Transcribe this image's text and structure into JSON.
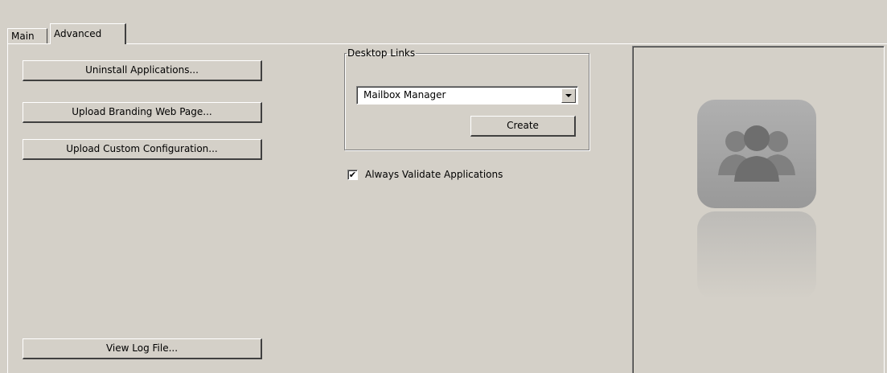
{
  "tabs": {
    "main": "Main",
    "advanced": "Advanced"
  },
  "left_buttons": {
    "uninstall": "Uninstall Applications...",
    "upload_branding": "Upload Branding Web Page...",
    "upload_config": "Upload Custom Configuration...",
    "view_log": "View Log File..."
  },
  "desktop_links": {
    "legend": "Desktop Links",
    "selected": "Mailbox Manager",
    "create_label": "Create"
  },
  "validate": {
    "label": "Always Validate Applications",
    "checked": true,
    "check_glyph": "✔"
  },
  "preview": {
    "icon": "users-group-icon",
    "colors": {
      "tile": "#a6a6a6",
      "figure": "#7f7f7f"
    }
  }
}
